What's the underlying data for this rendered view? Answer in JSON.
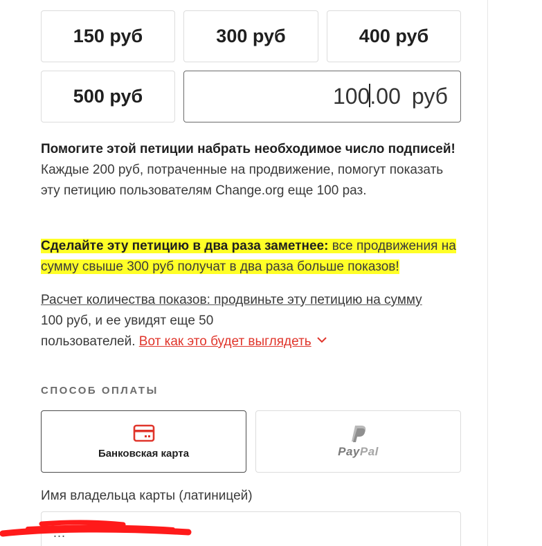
{
  "amounts": {
    "opt1": "150 руб",
    "opt2": "300 руб",
    "opt3": "400 руб",
    "opt4": "500 руб",
    "custom_value_a": "100",
    "custom_value_b": ".00",
    "currency": "руб"
  },
  "promo": {
    "bold": "Помогите этой петиции набрать необходимое число подписей!",
    "text": " Каждые 200 руб, потраченные на продвижение, помогут показать эту петицию пользователям Change.org еще 100 раз."
  },
  "highlight": {
    "bold": "Сделайте эту петицию в два раза заметнее:",
    "text": " все продвижения на сумму свыше 300 руб получат в два раза больше показов!"
  },
  "calc": {
    "underlined": "Расчет количества показов: продвиньте эту петицию на сумму",
    "line2": "100 руб, и ее увидят еще 50",
    "line3": "пользователей.",
    "link": "Вот как это будет выглядеть"
  },
  "payment": {
    "section_label": "СПОСОБ ОПЛАТЫ",
    "bank_label": "Банковская карта",
    "paypal_pay": "Pay",
    "paypal_pal": "Pal"
  },
  "card_holder": {
    "label": "Имя владельца карты (латиницей)",
    "value": "…"
  },
  "colors": {
    "accent_red": "#e0352b",
    "highlight_yellow": "#ffff27",
    "paypal_gray": "#8a8a8a"
  },
  "icons": {
    "card": "credit-card-icon",
    "chevron": "chevron-down-icon",
    "paypal": "paypal-logo"
  }
}
